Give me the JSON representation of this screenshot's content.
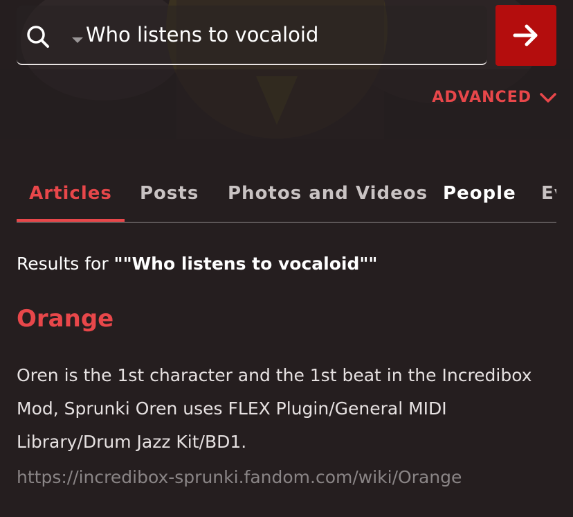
{
  "search": {
    "query": "Who listens to vocaloid",
    "search_icon": "search-icon",
    "submit_icon": "arrow-right-icon"
  },
  "advanced": {
    "label": "ADVANCED",
    "icon": "chevron-down-icon"
  },
  "tabs": [
    {
      "label": "Articles",
      "active": true
    },
    {
      "label": "Posts",
      "active": false
    },
    {
      "label": "Photos and Videos",
      "active": false
    },
    {
      "label": "People",
      "active": false
    },
    {
      "label": "Events",
      "active": false
    }
  ],
  "results": {
    "prefix": "Results for ",
    "query_quoted": "\"\"Who listens to vocaloid\"\"",
    "items": [
      {
        "title": "Orange",
        "snippet": "Oren is the 1st character and the 1st beat in the Incredibox Mod, Sprunki Oren uses FLEX Plugin/General MIDI Library/Drum Jazz Kit/BD1.",
        "url": "https://incredibox-sprunki.fandom.com/wiki/Orange"
      }
    ]
  },
  "colors": {
    "background": "#251e1f",
    "accent": "#e8474a",
    "submit_bg": "#b40d0d"
  }
}
